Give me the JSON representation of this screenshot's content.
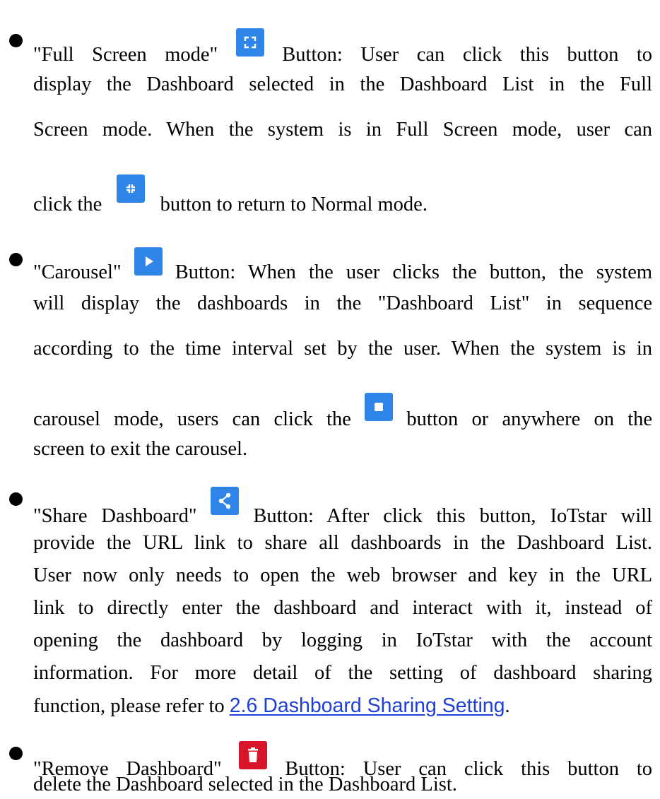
{
  "colors": {
    "icon_blue": "#2f86e8",
    "icon_red": "#d8152b",
    "link": "#1f3fd6"
  },
  "icons": {
    "fullscreen": "fullscreen-icon",
    "exit_fullscreen": "exit-fullscreen-icon",
    "play": "play-icon",
    "stop": "stop-icon",
    "share": "share-icon",
    "trash": "trash-icon"
  },
  "fullscreen": {
    "l1_title": "\"Full Screen mode\"",
    "l1_rest": "Button: User can click this button to",
    "l2": "display the Dashboard selected in the Dashboard List in the Full",
    "l3": "Screen mode. When the system is in Full Screen mode, user can",
    "l4_before": "click the",
    "l4_after": "button to return to Normal mode."
  },
  "carousel": {
    "l1_title": "\"Carousel\"",
    "l1_rest": "Button: When the user clicks the button, the system",
    "l2": "will display the dashboards in the \"Dashboard List\" in sequence",
    "l3": "according to the time interval set by the user. When the system is in",
    "l4_before": "carousel mode, users can click the",
    "l4_after": "button or anywhere on the",
    "l5": "screen to exit the carousel."
  },
  "share": {
    "l1_title": "\"Share Dashboard\"",
    "l1_rest": "Button: After click this button, IoTstar will",
    "l2": "provide the URL link to share all dashboards in the Dashboard List.",
    "l3": "User now only needs to open the web browser and key in the URL",
    "l4": "link to directly enter the dashboard and interact with it, instead of",
    "l5": "opening the dashboard by logging in IoTstar with the account",
    "l6": "information. For more detail of the setting of dashboard sharing",
    "l7_before": "function, please refer to",
    "l7_link": "2.6 Dashboard Sharing Setting",
    "l7_after": "."
  },
  "remove": {
    "l1_title": "\"Remove Dashboard\"",
    "l1_rest": "Button: User can click this button to",
    "l2": "delete the Dashboard selected in the Dashboard List."
  }
}
